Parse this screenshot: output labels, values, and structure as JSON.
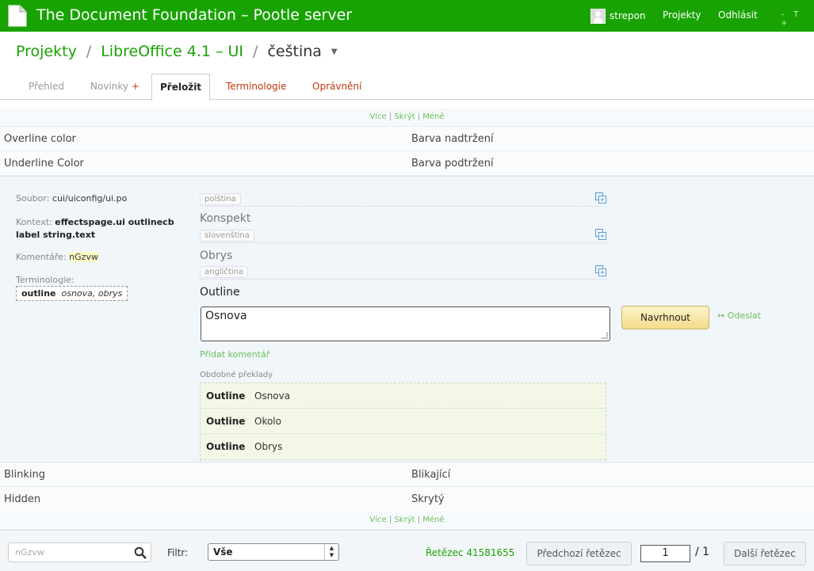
{
  "header": {
    "site_title": "The Document Foundation – Pootle server",
    "username": "strepon",
    "projects_link": "Projekty",
    "logout_link": "Odhlásit",
    "font_controls": "– T +"
  },
  "breadcrumb": {
    "projects": "Projekty",
    "sep1": "/",
    "project": "LibreOffice 4.1 – UI",
    "sep2": "/",
    "language": "čeština"
  },
  "tabs": [
    {
      "label": "Přehled"
    },
    {
      "label": "Novinky",
      "badge": "+"
    },
    {
      "label": "Přeložit"
    },
    {
      "label": "Terminologie"
    },
    {
      "label": "Oprávnění"
    }
  ],
  "view_controls": {
    "more": "Více",
    "hide": "Skrýt",
    "less": "Méně",
    "sep": "|"
  },
  "units_before": [
    {
      "source": "Overline color",
      "target": "Barva nadtržení"
    },
    {
      "source": "Underline Color",
      "target": "Barva podtržení"
    }
  ],
  "editor": {
    "file_label": "Soubor:",
    "file_value": "cui/uiconfig/ui.po",
    "context_label": "Kontext:",
    "context_value": "effectspage.ui outlinecb",
    "context_value2": "label string.text",
    "comments_label": "Komentáře:",
    "comments_value": "nGzvw",
    "terminology_label": "Terminologie:",
    "term_word": "outline",
    "term_translations": "osnova, obrys",
    "alt_sources": [
      {
        "language": "polština",
        "text": "Konspekt"
      },
      {
        "language": "slovenština",
        "text": "Obrys"
      },
      {
        "language": "angličtina",
        "text": "Outline"
      }
    ],
    "translation_value": "Osnova",
    "suggest_button": "Navrhnout",
    "submit_link": "↔ Odeslat",
    "add_comment": "Přidat komentář",
    "similar_title": "Obdobné překlady",
    "similar": [
      {
        "source": "Outline",
        "target": "Osnova"
      },
      {
        "source": "Outline",
        "target": "Okolo"
      },
      {
        "source": "Outline",
        "target": "Obrys"
      }
    ]
  },
  "units_after": [
    {
      "source": "Blinking",
      "target": "Blikající"
    },
    {
      "source": "Hidden",
      "target": "Skrytý"
    }
  ],
  "footer": {
    "search_placeholder": "nGzvw",
    "filter_label": "Filtr:",
    "filter_value": "Vše",
    "string_id": "Řetězec 41581655",
    "prev_button": "Předchozí řetězec",
    "page_current": "1",
    "page_total": "/ 1",
    "next_button": "Další řetězec"
  },
  "colors": {
    "brand": "#18a303",
    "accent_red": "#c0390e",
    "link_green": "#6abf5c"
  }
}
